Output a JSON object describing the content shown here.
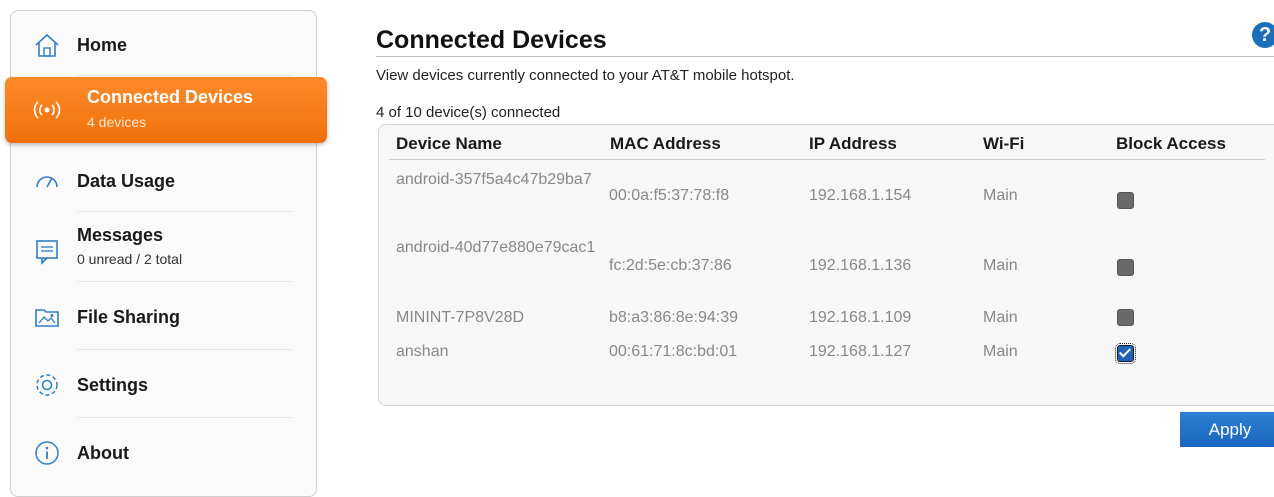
{
  "sidebar": {
    "items": [
      {
        "label": "Home",
        "icon": "home-icon"
      },
      {
        "label": "Connected Devices",
        "sublabel": "4 devices",
        "icon": "wifi-broadcast-icon",
        "active": true
      },
      {
        "label": "Data Usage",
        "icon": "gauge-icon"
      },
      {
        "label": "Messages",
        "sublabel": "0 unread / 2 total",
        "icon": "message-icon"
      },
      {
        "label": "File Sharing",
        "icon": "folder-image-icon"
      },
      {
        "label": "Settings",
        "icon": "gear-icon"
      },
      {
        "label": "About",
        "icon": "info-icon"
      }
    ]
  },
  "main": {
    "title": "Connected Devices",
    "help_symbol": "?",
    "description": "View devices currently connected to your AT&T mobile hotspot.",
    "count_text": "4 of 10 device(s) connected",
    "table": {
      "headers": [
        "Device Name",
        "MAC Address",
        "IP Address",
        "Wi-Fi",
        "Block Access"
      ],
      "rows": [
        {
          "name": "android-357f5a4c47b29ba7",
          "mac": "00:0a:f5:37:78:f8",
          "ip": "192.168.1.154",
          "wifi": "Main",
          "blocked": false
        },
        {
          "name": "android-40d77e880e79cac1",
          "mac": "fc:2d:5e:cb:37:86",
          "ip": "192.168.1.136",
          "wifi": "Main",
          "blocked": false
        },
        {
          "name": "MININT-7P8V28D",
          "mac": "b8:a3:86:8e:94:39",
          "ip": "192.168.1.109",
          "wifi": "Main",
          "blocked": false
        },
        {
          "name": "anshan",
          "mac": "00:61:71:8c:bd:01",
          "ip": "192.168.1.127",
          "wifi": "Main",
          "blocked": true
        }
      ]
    },
    "apply_label": "Apply"
  },
  "colors": {
    "accent_orange": "#f07a1a",
    "button_blue": "#1f6fc9",
    "icon_blue": "#2f7fc4"
  }
}
